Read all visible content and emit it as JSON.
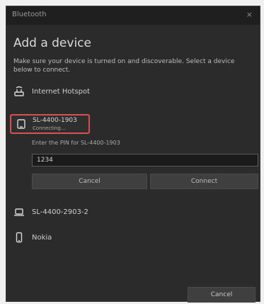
{
  "window": {
    "title": "Bluetooth",
    "close_glyph": "×"
  },
  "dialog": {
    "heading": "Add a device",
    "subtitle": "Make sure your device is turned on and discoverable. Select a device below to connect."
  },
  "devices": [
    {
      "name": "Internet Hotspot",
      "icon": "wifi-router-icon"
    },
    {
      "name": "SL-4400-1903",
      "status": "Connecting…",
      "icon": "tablet-icon",
      "selected": true
    },
    {
      "name": "SL-4400-2903-2",
      "icon": "laptop-icon"
    },
    {
      "name": "Nokia",
      "icon": "phone-icon"
    }
  ],
  "pin": {
    "label": "Enter the PIN for SL-4400-1903",
    "value": "1234"
  },
  "buttons": {
    "cancel": "Cancel",
    "connect": "Connect",
    "done": "Cancel"
  },
  "colors": {
    "window_bg": "#2b2b2b",
    "selection_border": "#d85050"
  }
}
